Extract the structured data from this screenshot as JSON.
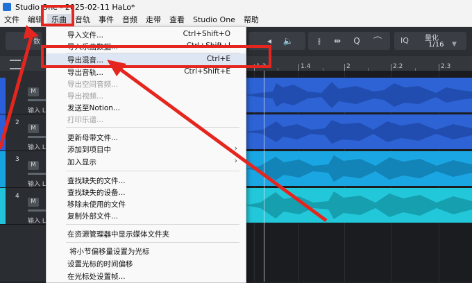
{
  "window": {
    "title": "Studio One - 2025-02-11 HaLo*"
  },
  "menubar": {
    "items": [
      {
        "label": "文件"
      },
      {
        "label": "编辑"
      },
      {
        "label": "乐曲"
      },
      {
        "label": "音轨"
      },
      {
        "label": "事件"
      },
      {
        "label": "音频"
      },
      {
        "label": "走带"
      },
      {
        "label": "查看"
      },
      {
        "label": "Studio One"
      },
      {
        "label": "帮助"
      }
    ]
  },
  "toolbar": {
    "partial_label": "数",
    "quantize_label": "量化",
    "quantize_value": "1/16",
    "iq_label": "IQ"
  },
  "ruler": {
    "labels": [
      "1.3",
      "1.4",
      "2",
      "2.2",
      "2.3"
    ]
  },
  "tracks": [
    {
      "num": "",
      "m": "M",
      "input": "输入 L",
      "color": "#2b5fd9"
    },
    {
      "num": "2",
      "m": "M",
      "input": "输入 L",
      "color": "#2b5fd9"
    },
    {
      "num": "3",
      "m": "M",
      "input": "输入 L",
      "color": "#17a2e0"
    },
    {
      "num": "4",
      "m": "M",
      "input": "输入 L",
      "color": "#20c3d8"
    }
  ],
  "dropdown": {
    "items": [
      {
        "label": "导入文件...",
        "shortcut": "Ctrl+Shift+O",
        "disabled": false
      },
      {
        "label": "导入乐曲数据...",
        "shortcut": "Ctrl+Shift+I",
        "disabled": false
      },
      {
        "label": "导出混音...",
        "shortcut": "Ctrl+E",
        "disabled": false,
        "highlight": true
      },
      {
        "label": "导出音轨...",
        "shortcut": "Ctrl+Shift+E",
        "disabled": false
      },
      {
        "label": "导出空间音频...",
        "shortcut": "",
        "disabled": true
      },
      {
        "label": "导出视频...",
        "shortcut": "",
        "disabled": true
      },
      {
        "label": "发送至Notion...",
        "shortcut": "",
        "disabled": false
      },
      {
        "label": "打印乐谱...",
        "shortcut": "",
        "disabled": true
      },
      {
        "label": "更新母带文件...",
        "shortcut": "",
        "disabled": false
      },
      {
        "label": "添加到项目中",
        "shortcut": "",
        "disabled": false,
        "submenu": true
      },
      {
        "label": "加入显示",
        "shortcut": "",
        "disabled": false,
        "submenu": true
      },
      {
        "label": "查找缺失的文件...",
        "shortcut": "",
        "disabled": false
      },
      {
        "label": "查找缺失的设备...",
        "shortcut": "",
        "disabled": false
      },
      {
        "label": "移除未使用的文件",
        "shortcut": "",
        "disabled": false
      },
      {
        "label": "复制外部文件...",
        "shortcut": "",
        "disabled": false
      },
      {
        "label": "在资源管理器中显示媒体文件夹",
        "shortcut": "",
        "disabled": false
      },
      {
        "label": "将小节偏移量设置为光标",
        "shortcut": "",
        "disabled": false
      },
      {
        "label": "设置光标的时间偏移",
        "shortcut": "",
        "disabled": false
      },
      {
        "label": "在光标处设置帧...",
        "shortcut": "",
        "disabled": false
      }
    ]
  },
  "colors": {
    "annotation": "#e5261f",
    "track_blue": "#2b5fd9",
    "track_cyan": "#20c3d8"
  }
}
